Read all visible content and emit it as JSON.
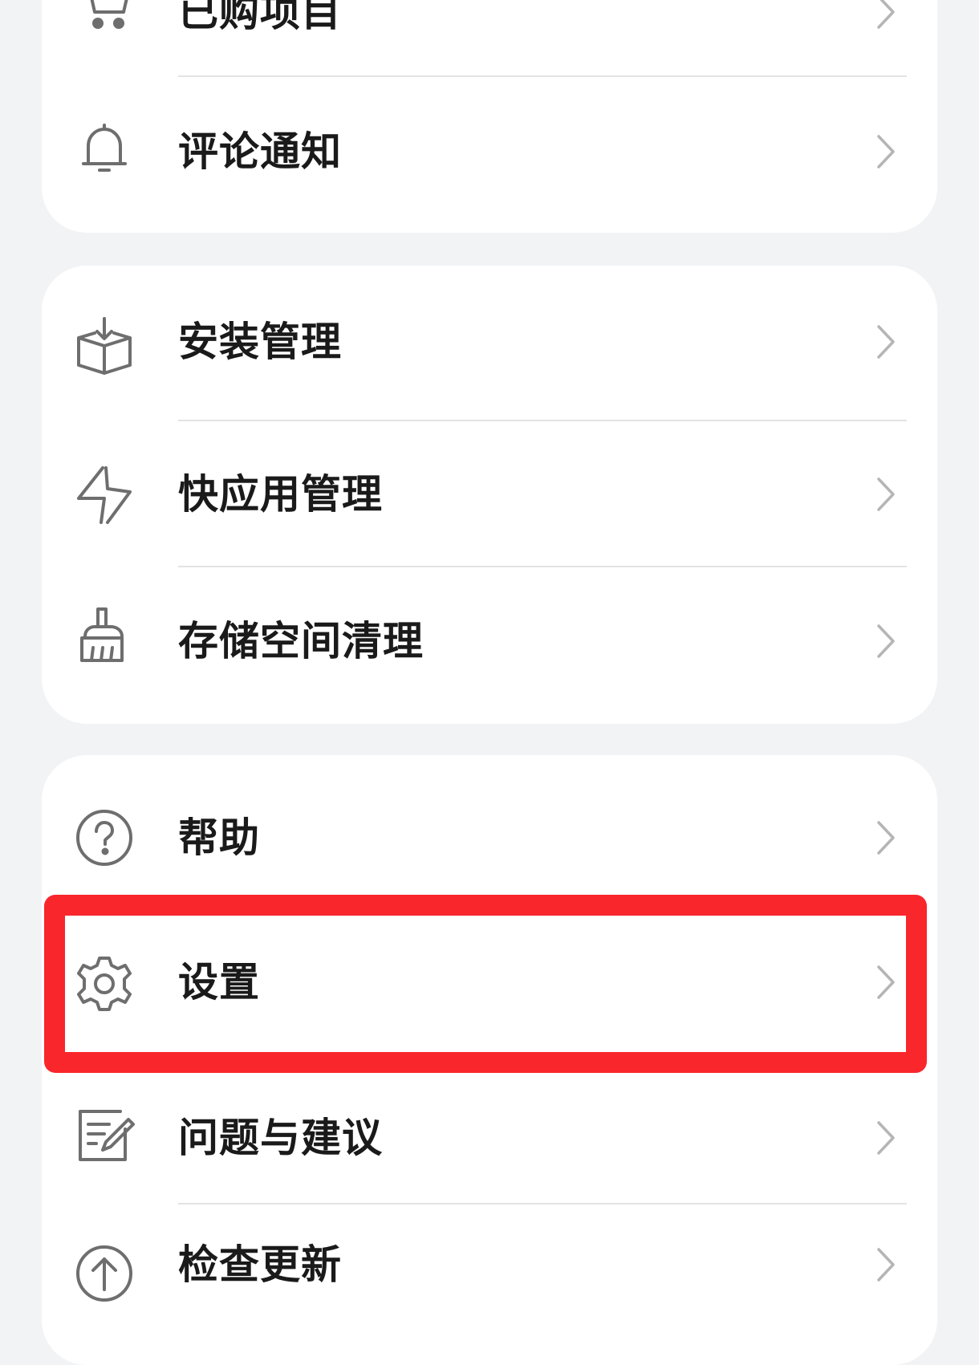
{
  "sections": [
    {
      "items": [
        {
          "label": "已购项目",
          "icon": "shopping-cart-icon"
        },
        {
          "label": "评论通知",
          "icon": "bell-icon"
        }
      ]
    },
    {
      "items": [
        {
          "label": "安装管理",
          "icon": "install-box-icon"
        },
        {
          "label": "快应用管理",
          "icon": "lightning-icon"
        },
        {
          "label": "存储空间清理",
          "icon": "broom-icon"
        }
      ]
    },
    {
      "items": [
        {
          "label": "帮助",
          "icon": "help-circle-icon"
        },
        {
          "label": "设置",
          "icon": "gear-icon"
        },
        {
          "label": "问题与建议",
          "icon": "feedback-edit-icon"
        },
        {
          "label": "检查更新",
          "icon": "upload-circle-icon"
        }
      ]
    }
  ],
  "colors": {
    "background": "#f1f3f5",
    "card": "#ffffff",
    "text": "#1a1a1a",
    "icon": "#6e6e6e",
    "chevron": "#b5b5b5",
    "highlight": "#f9262c"
  }
}
